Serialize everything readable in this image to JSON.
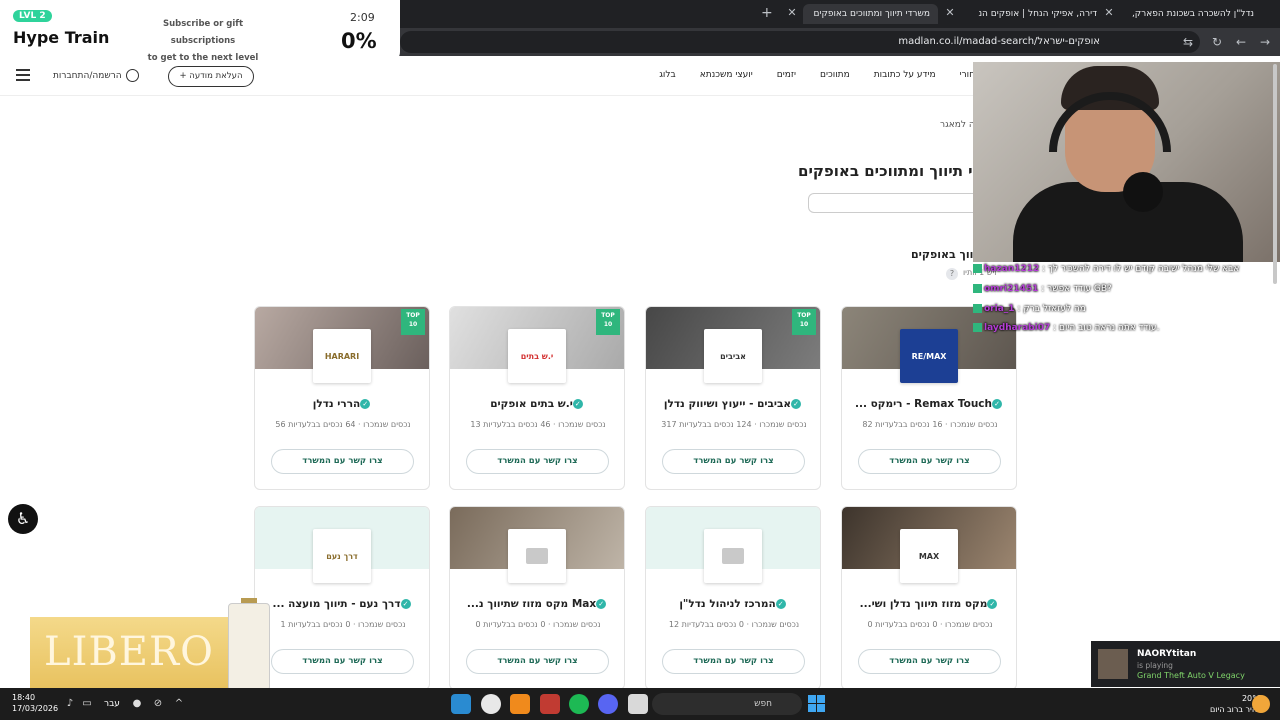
{
  "browser": {
    "tabs": [
      {
        "label": "נדל\"ן להשכרה בשכונת הפארק,"
      },
      {
        "label": "דירה, אפיקי הנחל | אופקים הנ"
      },
      {
        "label": "משרדי תיווך ומתווכים באופקים"
      }
    ],
    "url": "madlan.co.il/madad-search/אופקים-ישראל"
  },
  "site": {
    "login_label": "הרשמה/התחברות",
    "upload_label": "+ העלאת מודעה",
    "nav": [
      "חורי",
      "מידע על כתובות",
      "מתווכים",
      "יזמים",
      "יועצי משכנתא",
      "בלוג"
    ]
  },
  "hype_train": {
    "level": "LVL 2",
    "title": "Hype Train",
    "description_line1": "Subscribe or gift subscriptions",
    "description_line2": "to get to the next level",
    "timer": "2:09",
    "progress": "0%"
  },
  "page": {
    "breadcrumb": "ה למאגר",
    "title": "י תיווך ומתווכים באופקים",
    "section_title": "תיווך באופקים",
    "section_sub": "ויש 1 וותיו"
  },
  "cards": [
    {
      "name": "Remax Touch - רימקס ...",
      "stats": "82 נכסים שנמכרו · 16 נכסים בבלעדיות",
      "button": "צרו קשר עם המשרד",
      "logo": "RE/MAX",
      "top10": true
    },
    {
      "name": "אביבים - ייעוץ ושיווק נדלן",
      "stats": "317 נכסים שנמכרו · 124 נכסים בבלעדיות",
      "button": "צרו קשר עם המשרד",
      "logo": "אביבים",
      "top10": true
    },
    {
      "name": "י.ש בתים אופקים",
      "stats": "13 נכסים שנמכרו · 46 נכסים בבלעדיות",
      "button": "צרו קשר עם המשרד",
      "logo": "י.ש בתים",
      "top10": true
    },
    {
      "name": "הררי נדלן",
      "stats": "56 נכסים שנמכרו · 64 נכסים בבלעדיות",
      "button": "צרו קשר עם המשרד",
      "logo": "HARARI",
      "top10": true
    },
    {
      "name": "מקס מזוז תיווך נדלן ושי...",
      "stats": "0 נכסים שנמכרו · 0 נכסים בבלעדיות",
      "button": "צרו קשר עם המשרד",
      "logo": "MAX",
      "top10": false
    },
    {
      "name": "המרכז לניהול נדל\"ן",
      "stats": "12 נכסים שנמכרו · 0 נכסים בבלעדיות",
      "button": "צרו קשר עם המשרד",
      "logo": "",
      "top10": false
    },
    {
      "name": "Max מקס מזוז שתיווך נ...",
      "stats": "0 נכסים שנמכרו · 0 נכסים בבלעדיות",
      "button": "צרו קשר עם המשרד",
      "logo": "",
      "top10": false
    },
    {
      "name": "דרך נעם - תיווך מועצה ...",
      "stats": "1 נכסים שנמכרו · 0 נכסים בבלעדיות",
      "button": "צרו קשר עם המשרד",
      "logo": "דרך נעם",
      "top10": false
    }
  ],
  "top10_label": "TOP 10",
  "chat": [
    {
      "user": "hazan1212",
      "message": "אבא שלי מנהל ישיבה קודם יש לו דירה להשכיר לך"
    },
    {
      "user": "omri21451",
      "message": "עודד אפשר GB?"
    },
    {
      "user": "oria_1",
      "message": "מה לעזאזל ברק"
    },
    {
      "user": "laydharabi07",
      "message": "עודד אתה נראה טוב היום."
    }
  ],
  "ad": {
    "text": "LIBERO"
  },
  "now_playing": {
    "name": "NAORYtitan",
    "status": "is playing",
    "game": "Grand Theft Auto V Legacy"
  },
  "taskbar": {
    "time": "18:40",
    "date": "17/03/2026",
    "lang": "עבר",
    "search": "חפש",
    "temp": "20°C",
    "weather": "בהיר ברוב היום"
  }
}
